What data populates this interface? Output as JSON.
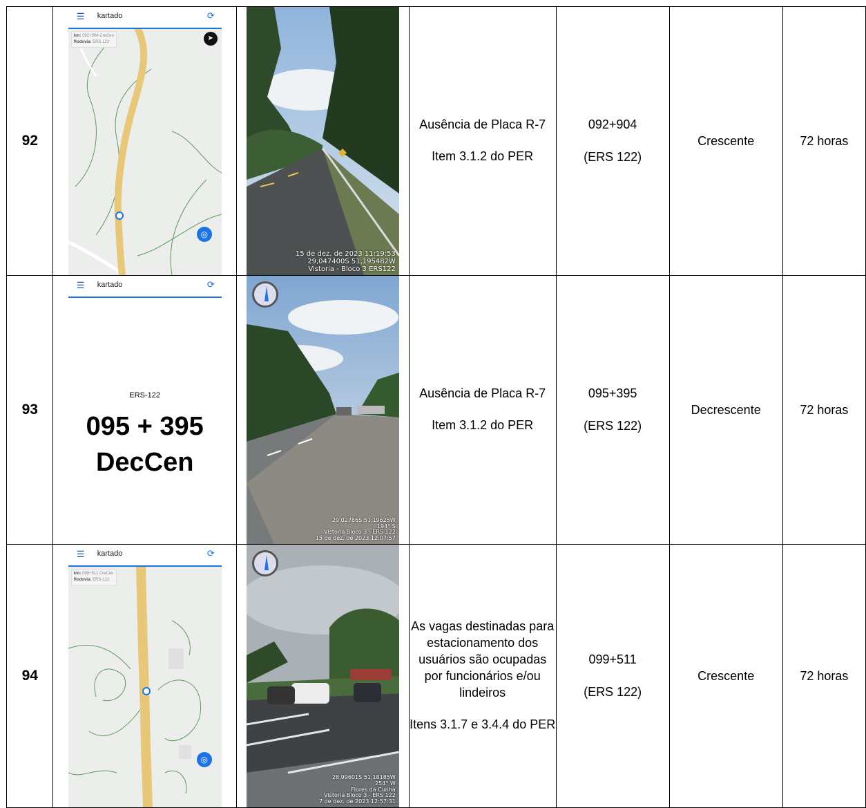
{
  "rows": [
    {
      "number": "92",
      "map": {
        "app_title": "kartado",
        "km_label": "km:",
        "km_value": "092+904 CreCen",
        "road_label": "Rodovia:",
        "road_value": "ERS 122"
      },
      "photo_stamp": [
        "15 de dez. de 2023 11:19:53",
        "29,047400S 51,195482W",
        "Vistoria - Bloco 3 ERS122"
      ],
      "description": [
        "Ausência de Placa R-7",
        "Item 3.1.2 do PER"
      ],
      "km": "092+904",
      "road": "(ERS 122)",
      "direction": "Crescente",
      "deadline": "72 horas"
    },
    {
      "number": "93",
      "map": {
        "app_title": "kartado",
        "road_caption": "ERS-122",
        "km_big": "095 + 395",
        "dir_big": "DecCen"
      },
      "photo_stamp": [
        "29,02786S 51,19625W",
        "194° S",
        "Vistoria Bloco 3 - ERS 122",
        "15 de dez. de 2023 12:07:57"
      ],
      "description": [
        "Ausência de Placa R-7",
        "Item 3.1.2 do PER"
      ],
      "km": "095+395",
      "road": "(ERS 122)",
      "direction": "Decrescente",
      "deadline": "72 horas"
    },
    {
      "number": "94",
      "map": {
        "app_title": "kartado",
        "km_label": "km:",
        "km_value": "099+511 CreCen",
        "road_label": "Rodovia:",
        "road_value": "ERS-122"
      },
      "photo_stamp": [
        "28,99601S 51,18185W",
        "254° W",
        "Flores da Cunha",
        "Vistoria Bloco 3 - ERS 122",
        "7 de dez. de 2023 12:57:31"
      ],
      "description": [
        "As vagas destinadas para estacionamento dos usuários são ocupadas por funcionários e/ou lindeiros",
        "Itens 3.1.7 e 3.4.4 do PER"
      ],
      "km": "099+511",
      "road": "(ERS 122)",
      "direction": "Crescente",
      "deadline": "72 horas"
    }
  ],
  "colors": {
    "road": "#e6c878",
    "app_accent": "#1a73e8",
    "map_bg": "#eceeec"
  },
  "icons": [
    "menu-icon",
    "sync-icon",
    "compass-icon",
    "locate-icon",
    "location-pin-icon"
  ]
}
